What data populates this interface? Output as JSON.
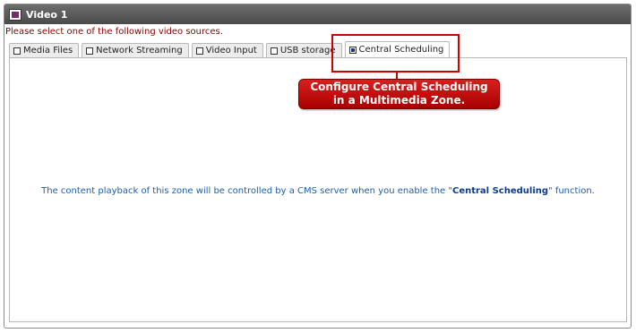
{
  "window": {
    "title": "Video 1",
    "icon": "video-window-icon"
  },
  "prompt": "Please select one of the following video sources.",
  "tabs": [
    {
      "label": "Media Files",
      "checked": false,
      "active": false
    },
    {
      "label": "Network Streaming",
      "checked": false,
      "active": false
    },
    {
      "label": "Video Input",
      "checked": false,
      "active": false
    },
    {
      "label": "USB storage",
      "checked": false,
      "active": false
    },
    {
      "label": "Central Scheduling",
      "checked": true,
      "active": true
    }
  ],
  "message": {
    "before": "The content playback of this zone will be controlled by a CMS server when you enable the \"",
    "emphasis": "Central Scheduling",
    "after": "\" function."
  },
  "callout": {
    "line1": "Configure Central Scheduling",
    "line2": "in a Multimedia Zone."
  },
  "colors": {
    "accent": "#d00000",
    "message": "#1a5fb4",
    "prompt": "#8b0000"
  }
}
